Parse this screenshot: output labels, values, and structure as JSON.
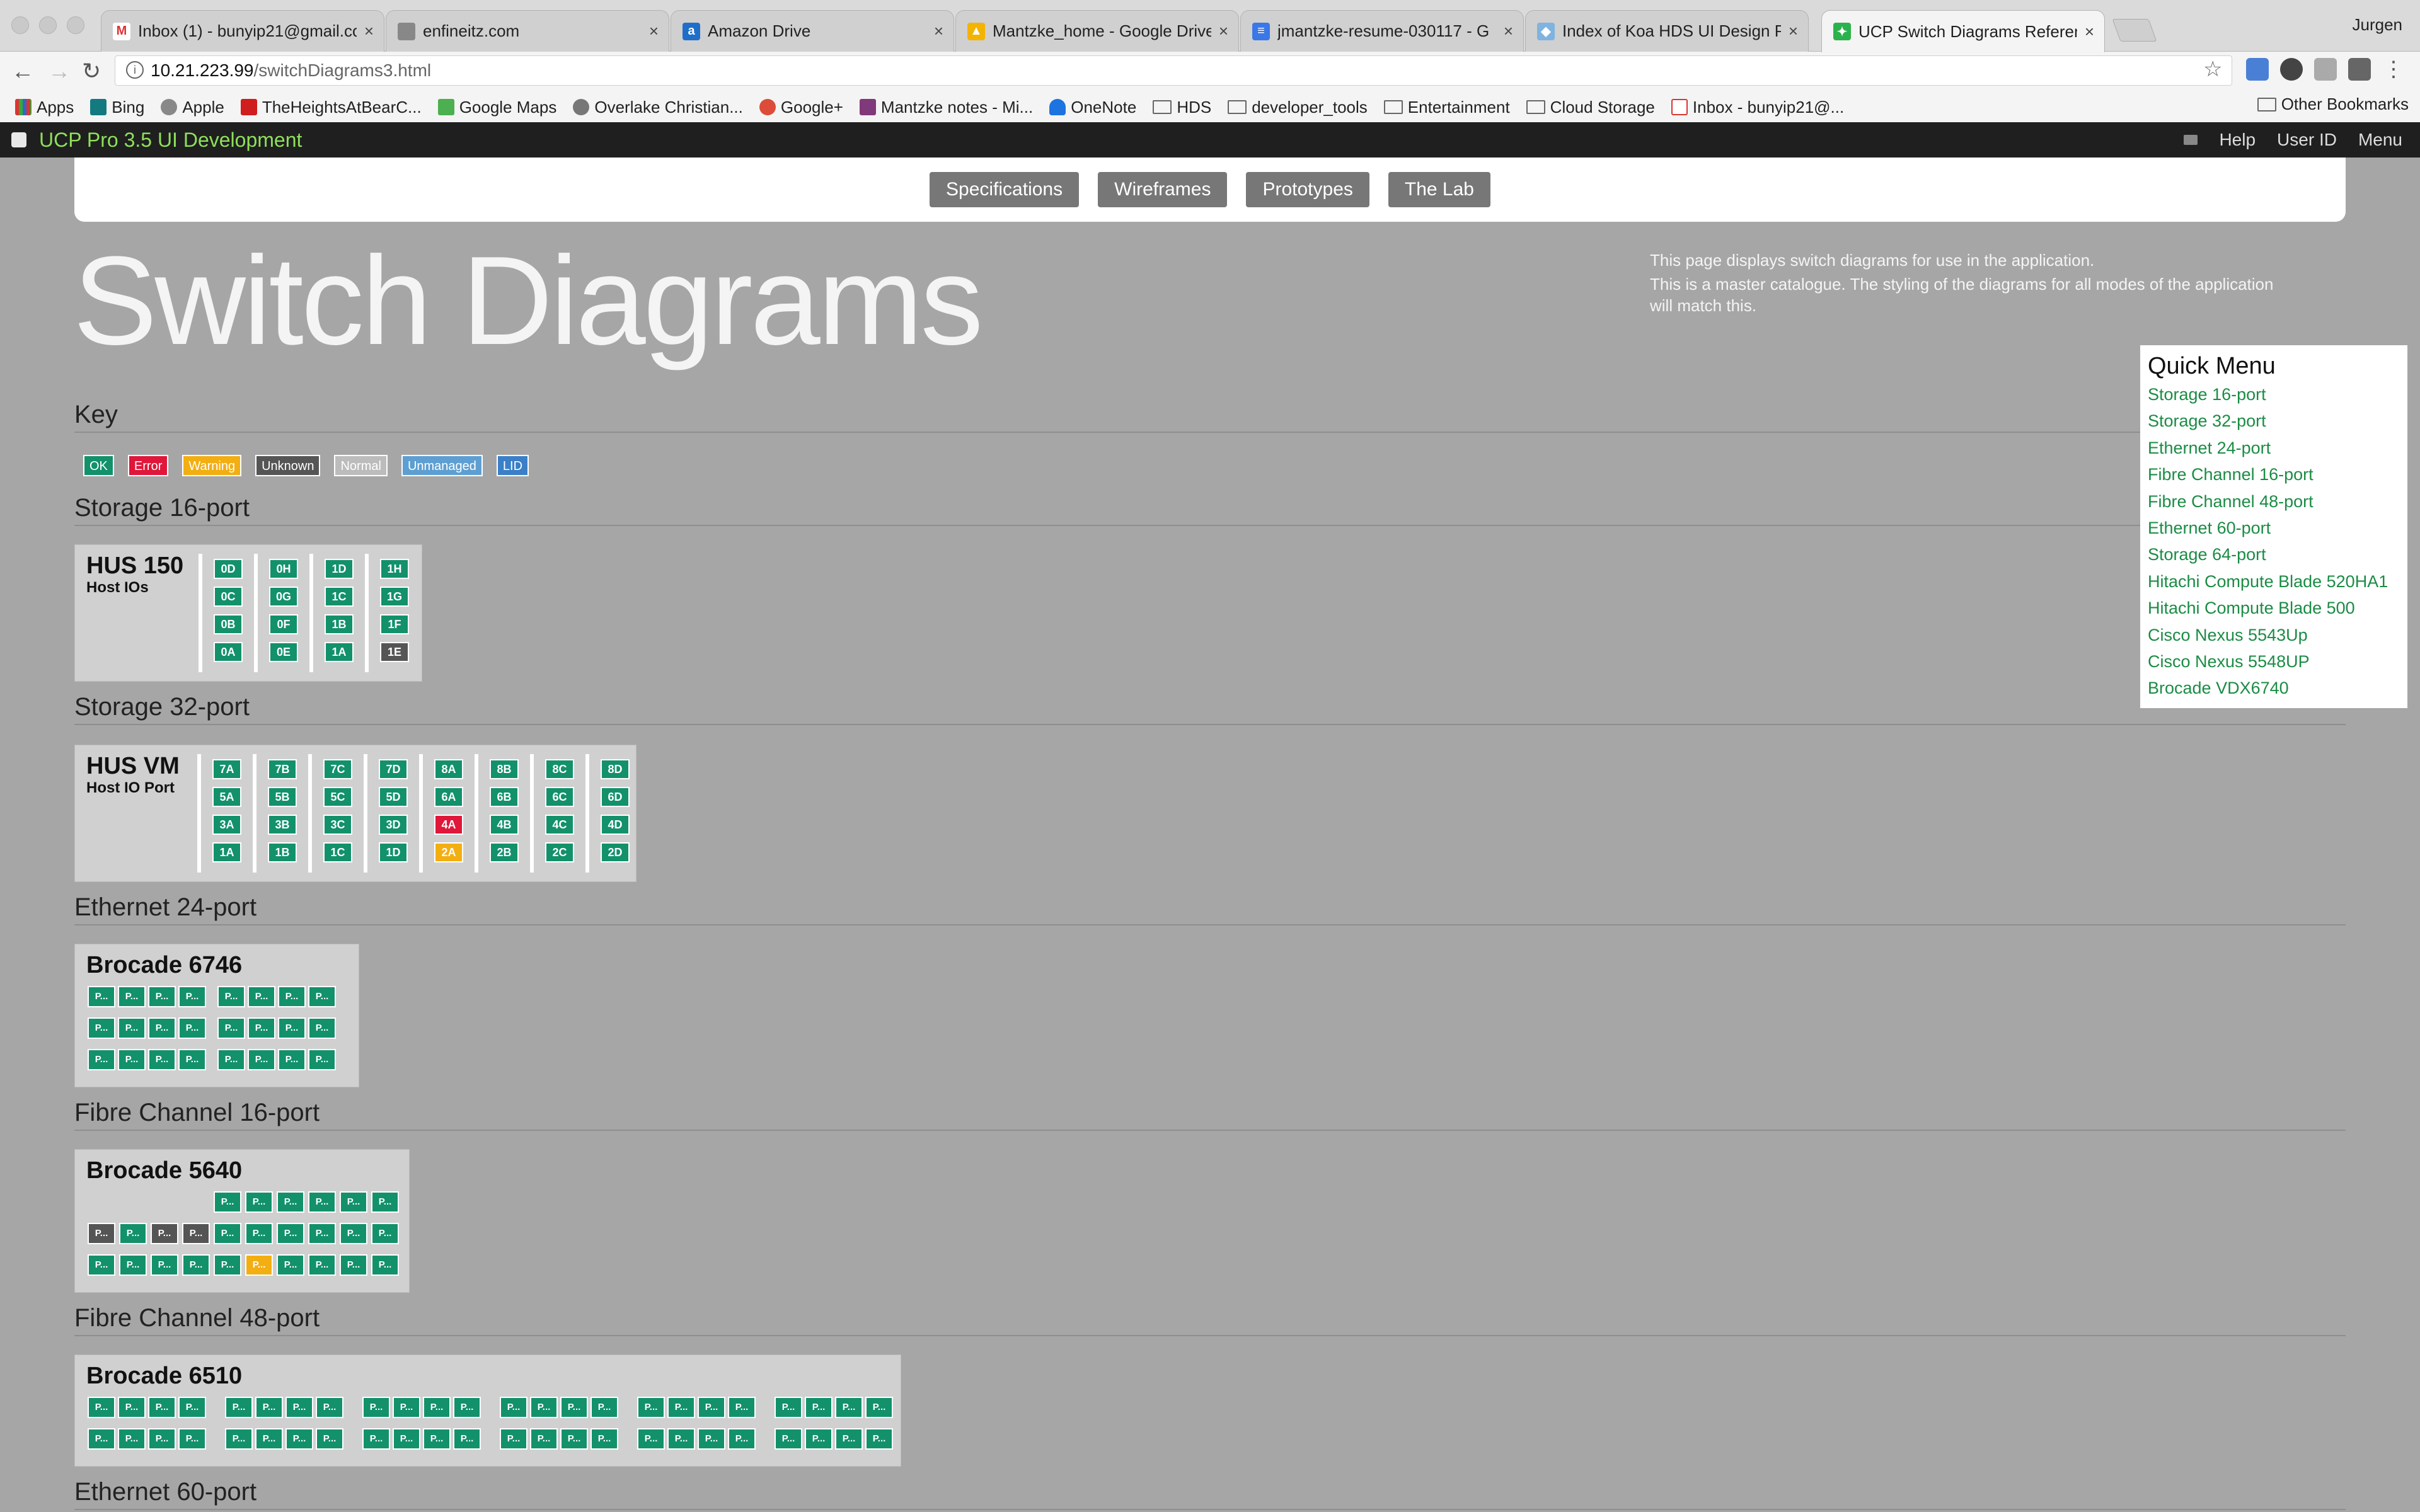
{
  "browser": {
    "tabs": [
      {
        "title": "Inbox (1) - bunyip21@gmail.co",
        "icon": "gmail-icon",
        "active": false
      },
      {
        "title": "enfineitz.com",
        "icon": "site-icon",
        "active": false
      },
      {
        "title": "Amazon Drive",
        "icon": "amazon-icon",
        "active": false
      },
      {
        "title": "Mantzke_home - Google Drive",
        "icon": "google-drive-icon",
        "active": false
      },
      {
        "title": "jmantzke-resume-030117 - G",
        "icon": "google-docs-icon",
        "active": false
      },
      {
        "title": "Index of Koa HDS UI Design Pa",
        "icon": "cube-icon",
        "active": false
      },
      {
        "title": "UCP Switch Diagrams Referen",
        "icon": "leaf-icon",
        "active": true
      }
    ],
    "user": "Jurgen",
    "url_host": "10.21.223.99",
    "url_path": "/switchDiagrams3.html",
    "bookmarks": [
      {
        "label": "Apps",
        "icon": "apps-icon"
      },
      {
        "label": "Bing",
        "icon": "bing-icon"
      },
      {
        "label": "Apple",
        "icon": "apple-icon"
      },
      {
        "label": "TheHeightsAtBearC...",
        "icon": "red-square-icon"
      },
      {
        "label": "Google Maps",
        "icon": "maps-icon"
      },
      {
        "label": "Overlake Christian...",
        "icon": "network-icon"
      },
      {
        "label": "Google+",
        "icon": "google-plus-icon"
      },
      {
        "label": "Mantzke notes - Mi...",
        "icon": "onenote-icon"
      },
      {
        "label": "OneNote",
        "icon": "cloud-icon"
      },
      {
        "label": "HDS",
        "icon": "folder-icon"
      },
      {
        "label": "developer_tools",
        "icon": "folder-icon"
      },
      {
        "label": "Entertainment",
        "icon": "folder-icon"
      },
      {
        "label": "Cloud Storage",
        "icon": "folder-icon"
      },
      {
        "label": "Inbox - bunyip21@...",
        "icon": "gmail-icon"
      }
    ],
    "other_bookmarks": "Other Bookmarks"
  },
  "app": {
    "title": "UCP Pro 3.5 UI Development",
    "right_links": [
      "Help",
      "User ID",
      "Menu"
    ]
  },
  "nav": {
    "buttons": [
      "Specifications",
      "Wireframes",
      "Prototypes",
      "The Lab"
    ]
  },
  "page": {
    "title": "Switch Diagrams",
    "intro": [
      "This page displays switch diagrams for use in the application.",
      "This is a master catalogue. The styling of the diagrams for all modes of the application will match this."
    ]
  },
  "key": {
    "heading": "Key",
    "badges": [
      {
        "label": "OK",
        "color": "#12916b"
      },
      {
        "label": "Error",
        "color": "#e0163a"
      },
      {
        "label": "Warning",
        "color": "#f3ae12"
      },
      {
        "label": "Unknown",
        "color": "#555555"
      },
      {
        "label": "Normal",
        "color": "#bcbcbc"
      },
      {
        "label": "Unmanaged",
        "color": "#5d9fd2"
      },
      {
        "label": "LID",
        "color": "#3a7fc8"
      }
    ]
  },
  "colors": {
    "ok": "#12916b",
    "error": "#e0163a",
    "warning": "#f3ae12",
    "unknown": "#555555"
  },
  "sections": {
    "storage16": {
      "heading": "Storage 16-port",
      "device": "HUS 150",
      "sub": "Host IOs",
      "columns": [
        [
          {
            "l": "0D",
            "s": "ok"
          },
          {
            "l": "0C",
            "s": "ok"
          },
          {
            "l": "0B",
            "s": "ok"
          },
          {
            "l": "0A",
            "s": "ok"
          }
        ],
        [
          {
            "l": "0H",
            "s": "ok"
          },
          {
            "l": "0G",
            "s": "ok"
          },
          {
            "l": "0F",
            "s": "ok"
          },
          {
            "l": "0E",
            "s": "ok"
          }
        ],
        [
          {
            "l": "1D",
            "s": "ok"
          },
          {
            "l": "1C",
            "s": "ok"
          },
          {
            "l": "1B",
            "s": "ok"
          },
          {
            "l": "1A",
            "s": "ok"
          }
        ],
        [
          {
            "l": "1H",
            "s": "ok"
          },
          {
            "l": "1G",
            "s": "ok"
          },
          {
            "l": "1F",
            "s": "ok"
          },
          {
            "l": "1E",
            "s": "unknown"
          }
        ]
      ]
    },
    "storage32": {
      "heading": "Storage 32-port",
      "device": "HUS VM",
      "sub": "Host IO Port",
      "columns": [
        [
          {
            "l": "7A",
            "s": "ok"
          },
          {
            "l": "5A",
            "s": "ok"
          },
          {
            "l": "3A",
            "s": "ok"
          },
          {
            "l": "1A",
            "s": "ok"
          }
        ],
        [
          {
            "l": "7B",
            "s": "ok"
          },
          {
            "l": "5B",
            "s": "ok"
          },
          {
            "l": "3B",
            "s": "ok"
          },
          {
            "l": "1B",
            "s": "ok"
          }
        ],
        [
          {
            "l": "7C",
            "s": "ok"
          },
          {
            "l": "5C",
            "s": "ok"
          },
          {
            "l": "3C",
            "s": "ok"
          },
          {
            "l": "1C",
            "s": "ok"
          }
        ],
        [
          {
            "l": "7D",
            "s": "ok"
          },
          {
            "l": "5D",
            "s": "ok"
          },
          {
            "l": "3D",
            "s": "ok"
          },
          {
            "l": "1D",
            "s": "ok"
          }
        ],
        [
          {
            "l": "8A",
            "s": "ok"
          },
          {
            "l": "6A",
            "s": "ok"
          },
          {
            "l": "4A",
            "s": "error"
          },
          {
            "l": "2A",
            "s": "warning"
          }
        ],
        [
          {
            "l": "8B",
            "s": "ok"
          },
          {
            "l": "6B",
            "s": "ok"
          },
          {
            "l": "4B",
            "s": "ok"
          },
          {
            "l": "2B",
            "s": "ok"
          }
        ],
        [
          {
            "l": "8C",
            "s": "ok"
          },
          {
            "l": "6C",
            "s": "ok"
          },
          {
            "l": "4C",
            "s": "ok"
          },
          {
            "l": "2C",
            "s": "ok"
          }
        ],
        [
          {
            "l": "8D",
            "s": "ok"
          },
          {
            "l": "6D",
            "s": "ok"
          },
          {
            "l": "4D",
            "s": "ok"
          },
          {
            "l": "2D",
            "s": "ok"
          }
        ]
      ]
    },
    "ethernet24": {
      "heading": "Ethernet 24-port",
      "device": "Brocade 6746",
      "port_label": "P...",
      "rows": [
        [
          "ok",
          "ok",
          "ok",
          "ok",
          "ok",
          "ok",
          "ok",
          "ok"
        ],
        [
          "ok",
          "ok",
          "ok",
          "ok",
          "ok",
          "ok",
          "ok",
          "ok"
        ],
        [
          "ok",
          "ok",
          "ok",
          "ok",
          "ok",
          "ok",
          "ok",
          "ok"
        ]
      ]
    },
    "fc16": {
      "heading": "Fibre Channel 16-port",
      "device": "Brocade 5640",
      "port_label": "P...",
      "rows": [
        [
          null,
          null,
          null,
          null,
          "ok",
          "ok",
          "ok",
          "ok",
          "ok",
          "ok"
        ],
        [
          "unknown",
          "ok",
          "unknown",
          "unknown",
          "ok",
          "ok",
          "ok",
          "ok",
          "ok",
          "ok"
        ],
        [
          "ok",
          "ok",
          "ok",
          "ok",
          "ok",
          "warning",
          "ok",
          "ok",
          "ok",
          "ok"
        ]
      ]
    },
    "fc48": {
      "heading": "Fibre Channel 48-port",
      "device": "Brocade 6510",
      "port_label": "P...",
      "rows": [
        [
          "ok",
          "ok",
          "ok",
          "ok",
          "ok",
          "ok",
          "ok",
          "ok",
          "ok",
          "ok",
          "ok",
          "ok",
          "ok",
          "ok",
          "ok",
          "ok",
          "ok",
          "ok",
          "ok",
          "ok",
          "ok",
          "ok",
          "ok",
          "ok"
        ],
        [
          "ok",
          "ok",
          "ok",
          "ok",
          "ok",
          "ok",
          "ok",
          "ok",
          "ok",
          "ok",
          "ok",
          "ok",
          "ok",
          "ok",
          "ok",
          "ok",
          "ok",
          "ok",
          "ok",
          "ok",
          "ok",
          "ok",
          "ok",
          "ok"
        ]
      ]
    },
    "ethernet60": {
      "heading": "Ethernet 60-port"
    }
  },
  "quick_menu": {
    "title": "Quick Menu",
    "items": [
      "Storage 16-port",
      "Storage 32-port",
      "Ethernet 24-port",
      "Fibre Channel 16-port",
      "Fibre Channel 48-port",
      "Ethernet 60-port",
      "Storage 64-port",
      "Hitachi Compute Blade 520HA1",
      "Hitachi Compute Blade 500",
      "Cisco Nexus 5543Up",
      "Cisco Nexus 5548UP",
      "Brocade VDX6740"
    ]
  }
}
